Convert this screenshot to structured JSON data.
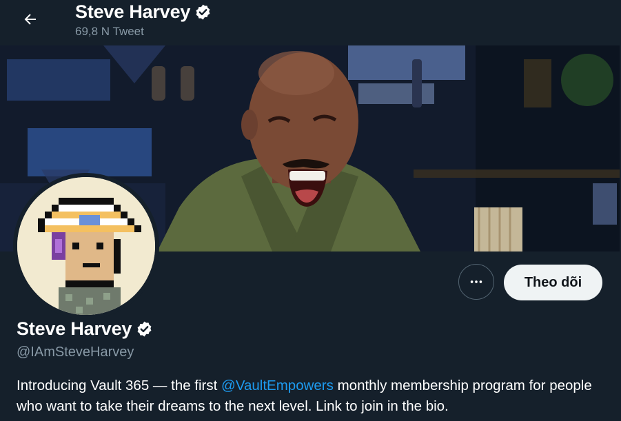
{
  "header": {
    "name": "Steve Harvey",
    "tweet_count": "69,8 N Tweet"
  },
  "actions": {
    "follow_label": "Theo dõi"
  },
  "profile": {
    "display_name": "Steve Harvey",
    "handle": "@IAmSteveHarvey",
    "bio_before": "Introducing Vault 365 — the first ",
    "bio_mention": "@VaultEmpowers",
    "bio_after": " monthly membership program for people who want to take their dreams to the next level. Link to join in the bio."
  },
  "colors": {
    "background": "#15202b",
    "verified_badge": "#ffffff",
    "link": "#1d9bf0",
    "secondary_text": "#8899a6",
    "follow_button_bg": "#eff3f4"
  },
  "icons": {
    "back": "arrow-left-icon",
    "verified": "verified-badge-icon",
    "more": "more-horizontal-icon"
  }
}
